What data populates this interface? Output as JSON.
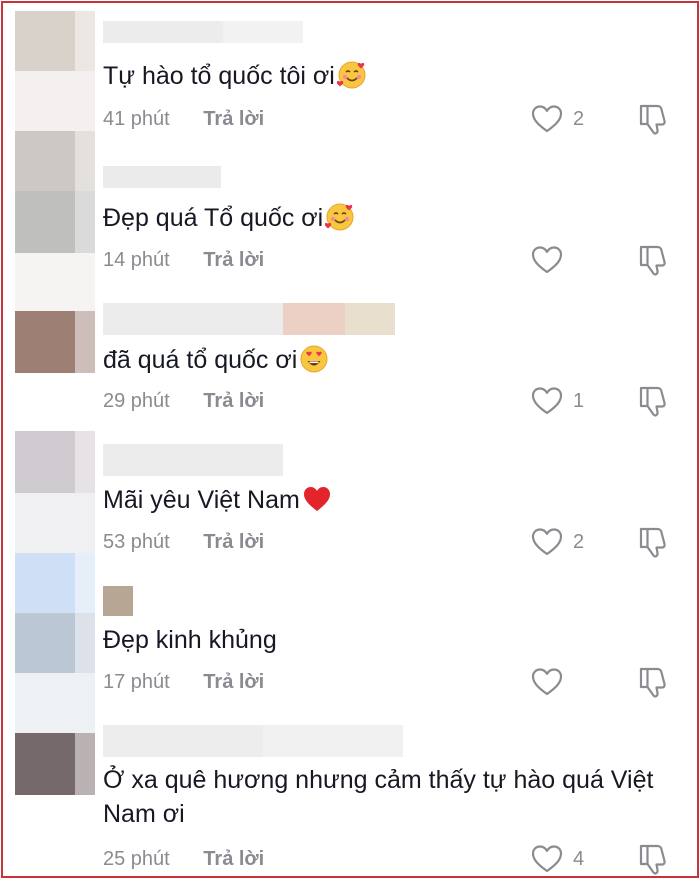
{
  "comments": [
    {
      "text": "Tự hào tổ quốc tôi ơi",
      "emoji": "smiling-face-with-hearts-icon",
      "time": "41 phút",
      "reply": "Trả lời",
      "likes": "2"
    },
    {
      "text": "Đẹp quá Tổ quốc ơi",
      "emoji": "smiling-face-with-hearts-icon",
      "time": "14 phút",
      "reply": "Trả lời",
      "likes": ""
    },
    {
      "text": "đã quá tổ quốc ơi",
      "emoji": "heart-eyes-icon",
      "time": "29 phút",
      "reply": "Trả lời",
      "likes": "1"
    },
    {
      "text": "Mãi yêu Việt Nam",
      "emoji": "red-heart-icon",
      "time": "53 phút",
      "reply": "Trả lời",
      "likes": "2"
    },
    {
      "text": "Đẹp kinh khủng",
      "emoji": "",
      "time": "17 phút",
      "reply": "Trả lời",
      "likes": ""
    },
    {
      "text": "Ở xa quê hương nhưng cảm thấy tự hào quá Việt Nam ơi",
      "emoji": "",
      "time": "25 phút",
      "reply": "Trả lời",
      "likes": "4"
    }
  ],
  "colors": {
    "border": "#c8323a",
    "text": "#161823",
    "meta": "#8a8b91"
  }
}
